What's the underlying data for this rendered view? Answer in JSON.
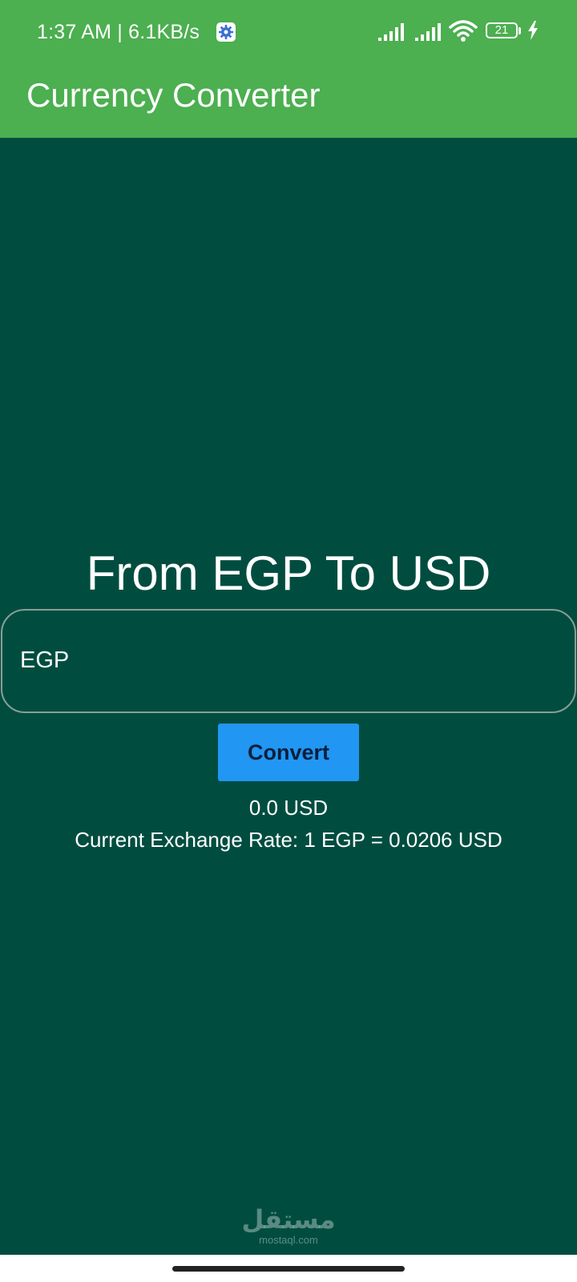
{
  "status_bar": {
    "time": "1:37 AM | 6.1KB/s",
    "battery_level": "21",
    "icons": [
      "gear-icon",
      "signal-icon",
      "wifi-icon",
      "battery-icon",
      "charging-icon"
    ]
  },
  "app_bar": {
    "title": "Currency Converter"
  },
  "main": {
    "heading": "From EGP To USD",
    "amount_input": {
      "placeholder": "EGP",
      "value": ""
    },
    "convert_label": "Convert",
    "result": "0.0 USD",
    "exchange_rate": "Current Exchange Rate: 1 EGP = 0.0206 USD"
  },
  "watermark": {
    "arabic": "مستقل",
    "latin": "mostaql.com"
  },
  "colors": {
    "app_bar": "#4caf50",
    "background": "#004d40",
    "button": "#2196f3",
    "button_text": "#0b1f3a",
    "text": "#ffffff"
  }
}
